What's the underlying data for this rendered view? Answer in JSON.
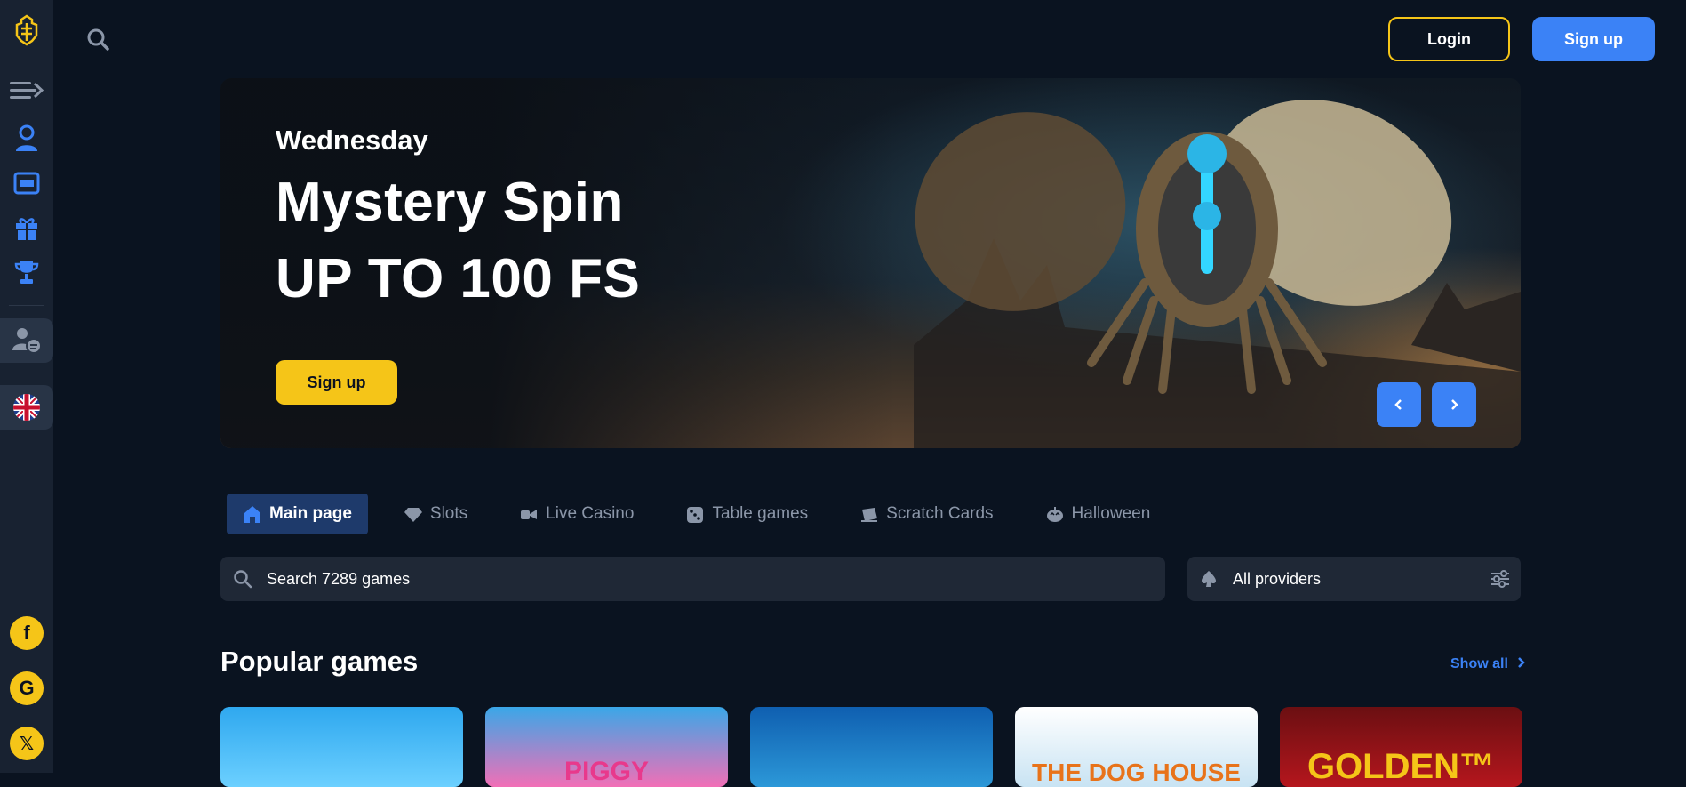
{
  "header": {
    "login_label": "Login",
    "signup_label": "Sign up"
  },
  "sidebar": {
    "items": [
      "menu-icon",
      "user-support-icon",
      "slot-machine-icon",
      "gift-icon",
      "trophy-icon",
      "chat-support-icon",
      "uk-flag-icon"
    ],
    "social": [
      "facebook-icon",
      "google-icon",
      "x-icon"
    ],
    "social_glyphs": [
      "f",
      "G",
      "𝕏"
    ]
  },
  "banner": {
    "day": "Wednesday",
    "title": "Mystery Spin",
    "subtitle": "UP TO 100 FS",
    "cta": "Sign up"
  },
  "tabs": [
    {
      "label": "Main page",
      "icon": "home-icon",
      "active": true
    },
    {
      "label": "Slots",
      "icon": "diamond-icon",
      "active": false
    },
    {
      "label": "Live Casino",
      "icon": "live-camera-icon",
      "active": false
    },
    {
      "label": "Table games",
      "icon": "dice-icon",
      "active": false
    },
    {
      "label": "Scratch Cards",
      "icon": "scratch-card-icon",
      "active": false
    },
    {
      "label": "Halloween",
      "icon": "pumpkin-icon",
      "active": false
    }
  ],
  "search": {
    "placeholder": "Search 7289 games"
  },
  "providers": {
    "label": "All providers"
  },
  "popular": {
    "title": "Popular games",
    "show_all": "Show all",
    "games": [
      {
        "title": "",
        "color_top": "#2fa8ef",
        "color_bottom": "#6cd0ff"
      },
      {
        "title": "PIGGY",
        "color_top": "#3aa7e8",
        "color_bottom": "#f26fb6"
      },
      {
        "title": "",
        "color_top": "#0f5fb0",
        "color_bottom": "#2c98d8"
      },
      {
        "title": "THE DOG HOUSE",
        "color_top": "#ffffff",
        "color_bottom": "#c8e3f3"
      },
      {
        "title": "GOLDEN™",
        "color_top": "#6b0f12",
        "color_bottom": "#b5161d"
      }
    ]
  },
  "colors": {
    "accent_yellow": "#f5c518",
    "accent_blue": "#3b82f6",
    "background": "#0a1320",
    "sidebar": "#182231"
  }
}
